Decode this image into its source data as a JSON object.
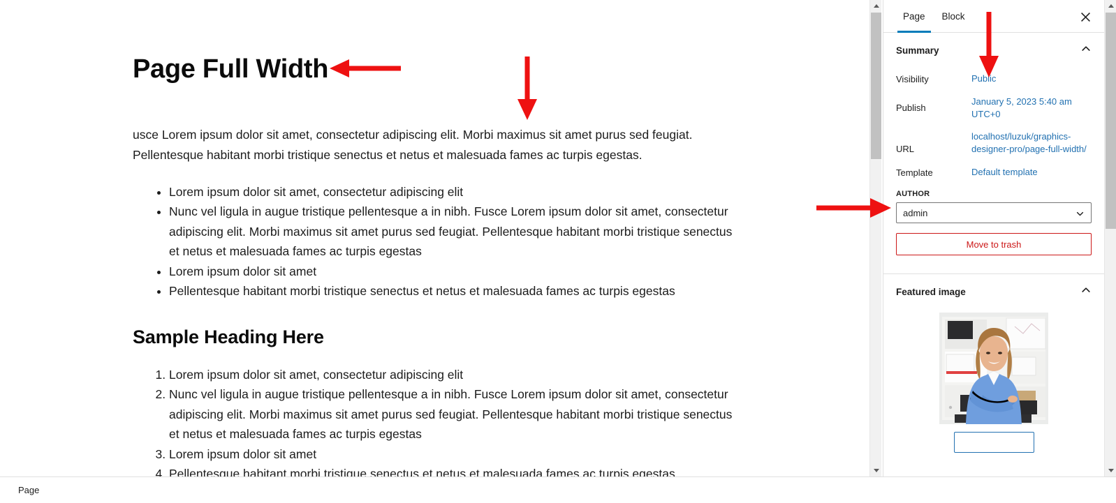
{
  "editor": {
    "page_title": "Page Full Width",
    "paragraph": "usce Lorem ipsum dolor sit amet, consectetur adipiscing elit. Morbi maximus sit amet purus sed feugiat. Pellentesque habitant morbi tristique senectus et netus et malesuada fames ac turpis egestas.",
    "bullet_items": [
      "Lorem ipsum dolor sit amet, consectetur adipiscing elit",
      "Nunc vel ligula in augue tristique pellentesque a in nibh. Fusce Lorem ipsum dolor sit amet, consectetur adipiscing elit. Morbi maximus sit amet purus sed feugiat. Pellentesque habitant morbi tristique senectus et netus et malesuada fames ac turpis egestas",
      "Lorem ipsum dolor sit amet",
      "Pellentesque habitant morbi tristique senectus et netus et malesuada fames ac turpis egestas"
    ],
    "section_heading": "Sample Heading Here",
    "numbered_items": [
      "Lorem ipsum dolor sit amet, consectetur adipiscing elit",
      "Nunc vel ligula in augue tristique pellentesque a in nibh. Fusce Lorem ipsum dolor sit amet, consectetur adipiscing elit. Morbi maximus sit amet purus sed feugiat. Pellentesque habitant morbi tristique senectus et netus et malesuada fames ac turpis egestas",
      "Lorem ipsum dolor sit amet",
      "Pellentesque habitant morbi tristique senectus et netus et malesuada fames ac turpis egestas"
    ]
  },
  "status_bar": {
    "breadcrumb": "Page"
  },
  "sidebar": {
    "tabs": [
      {
        "label": "Page",
        "active": true
      },
      {
        "label": "Block",
        "active": false
      }
    ],
    "close_icon": "close-icon",
    "summary": {
      "title": "Summary",
      "collapse_icon": "chevron-up-icon",
      "rows": [
        {
          "label": "Visibility",
          "value": "Public"
        },
        {
          "label": "Publish",
          "value": "January 5, 2023 5:40 am UTC+0"
        },
        {
          "label": "URL",
          "value": "localhost/luzuk/graphics-designer-pro/page-full-width/"
        },
        {
          "label": "Template",
          "value": "Default template"
        }
      ],
      "author_label": "AUTHOR",
      "author_value": "admin",
      "author_caret_icon": "chevron-down-icon",
      "trash_label": "Move to trash"
    },
    "featured_image": {
      "title": "Featured image",
      "collapse_icon": "chevron-up-icon",
      "image_alt": "smiling woman in blue blazer standing in office"
    }
  },
  "annotations": {
    "accent_color": "#ee1111",
    "arrows": [
      {
        "name": "arrow-to-page-title",
        "direction": "left"
      },
      {
        "name": "arrow-to-paragraph",
        "direction": "down"
      },
      {
        "name": "arrow-to-visibility-public",
        "direction": "down"
      },
      {
        "name": "arrow-to-template",
        "direction": "right"
      }
    ]
  },
  "colors": {
    "link": "#2271b1",
    "active_tab": "#007cba",
    "danger": "#cc1818"
  }
}
